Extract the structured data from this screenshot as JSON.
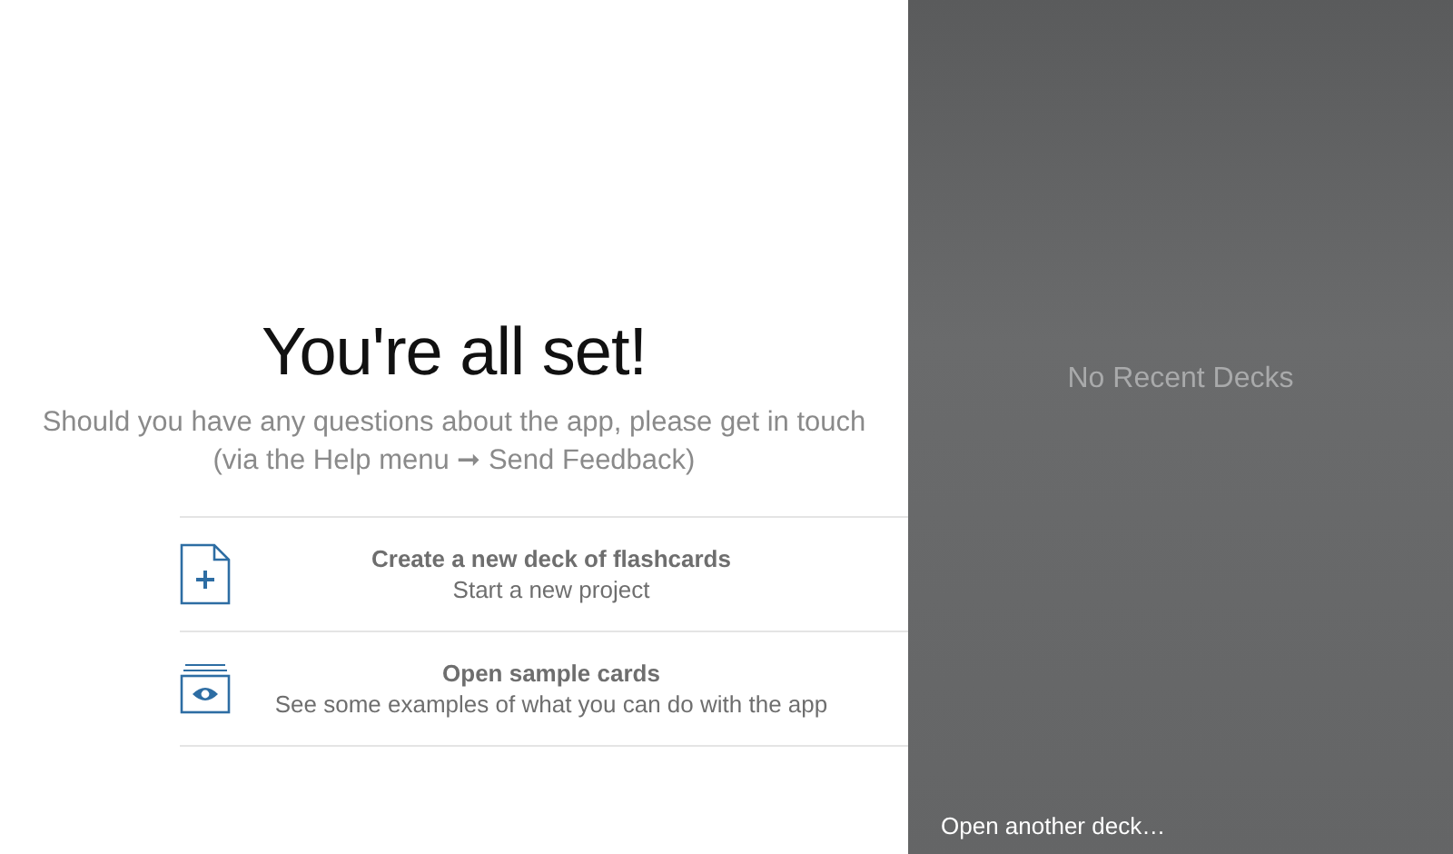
{
  "welcome": {
    "title": "You're all set!",
    "message_lines": [
      "Should you have any questions about the app, please get in touch",
      "(via the Help menu ➞ Send Feedback)"
    ]
  },
  "actions": [
    {
      "kind": "new",
      "title": "Create a new deck of flashcards",
      "subtitle": "Start a new project"
    },
    {
      "kind": "sample",
      "title": "Open sample cards",
      "subtitle": "See some examples of what you can do with the app"
    }
  ],
  "recent": {
    "empty_message": "No Recent Decks",
    "open_link": "Open another deck…"
  }
}
